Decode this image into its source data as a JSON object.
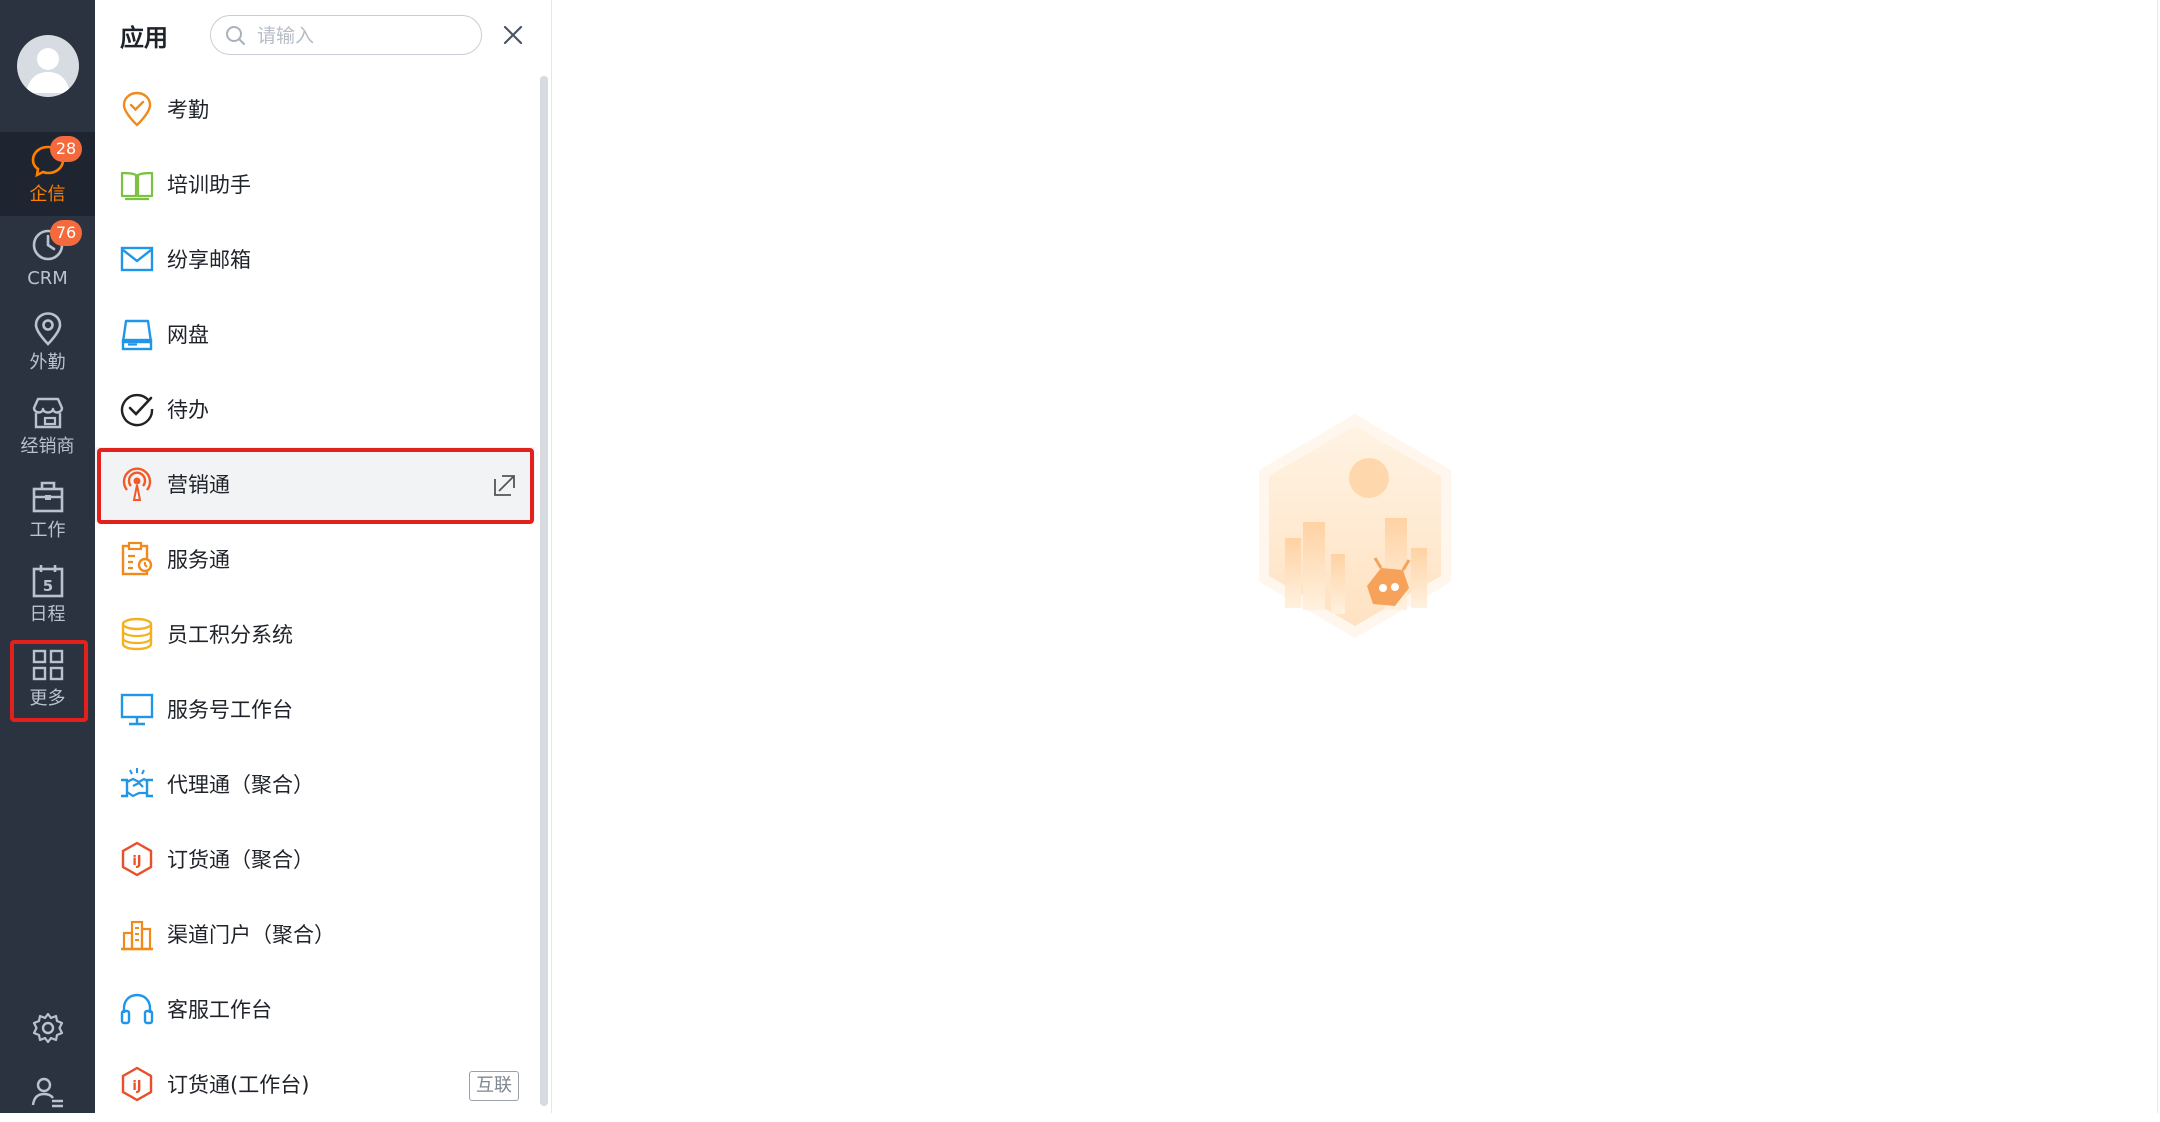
{
  "nav": {
    "items": [
      {
        "label": "企信",
        "badge": "28",
        "icon": "chat-icon",
        "active": true
      },
      {
        "label": "CRM",
        "badge": "76",
        "icon": "clock-icon"
      },
      {
        "label": "外勤",
        "icon": "location-pin-icon"
      },
      {
        "label": "经销商",
        "icon": "store-icon"
      },
      {
        "label": "工作",
        "icon": "briefcase-icon"
      },
      {
        "label": "日程",
        "icon": "calendar-icon",
        "calendar_day": "5"
      },
      {
        "label": "更多",
        "icon": "grid-icon"
      }
    ],
    "bottom": [
      {
        "icon": "settings-icon"
      },
      {
        "icon": "user-profile-icon"
      }
    ]
  },
  "panel": {
    "title": "应用",
    "search_placeholder": "请输入",
    "apps": [
      {
        "label": "考勤",
        "icon": "attendance-pin-icon"
      },
      {
        "label": "培训助手",
        "icon": "book-icon"
      },
      {
        "label": "纷享邮箱",
        "icon": "mail-icon"
      },
      {
        "label": "网盘",
        "icon": "drive-icon"
      },
      {
        "label": "待办",
        "icon": "check-circle-icon"
      },
      {
        "label": "营销通",
        "icon": "broadcast-icon",
        "selected": true
      },
      {
        "label": "服务通",
        "icon": "service-clipboard-icon"
      },
      {
        "label": "员工积分系统",
        "icon": "coins-stack-icon"
      },
      {
        "label": "服务号工作台",
        "icon": "monitor-icon"
      },
      {
        "label": "代理通（聚合）",
        "icon": "handshake-icon"
      },
      {
        "label": "订货通（聚合）",
        "icon": "order-hex-icon"
      },
      {
        "label": "渠道门户（聚合）",
        "icon": "buildings-icon"
      },
      {
        "label": "客服工作台",
        "icon": "headset-icon"
      },
      {
        "label": "订货通(工作台)",
        "icon": "order-hex-icon",
        "tag": "互联"
      }
    ]
  },
  "colors": {
    "nav_bg": "#2b3340",
    "accent": "#ff8000",
    "badge": "#f46a3c",
    "highlight": "#e2211c"
  }
}
